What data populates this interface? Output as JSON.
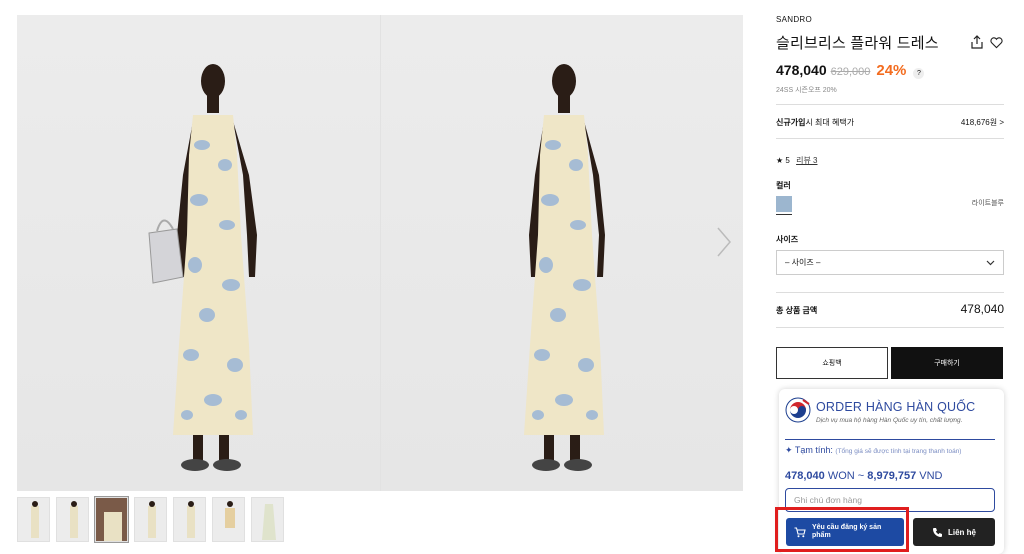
{
  "product": {
    "brand": "SANDRO",
    "title": "슬리브리스 플라워 드레스",
    "price": "478,040",
    "original_price": "629,000",
    "discount": "24%",
    "help_icon": "?",
    "season_note": "24SS 시즌오프 20%"
  },
  "benefit": {
    "label_bold": "신규가입",
    "label_rest": "시 최대 혜택가",
    "value": "418,676원 >"
  },
  "rating": {
    "star": "★ 5",
    "review_link": "리뷰 3"
  },
  "color": {
    "label": "컬러",
    "selected_name": "라이트블루",
    "swatch_color": "#9cb6cf"
  },
  "size": {
    "label": "사이즈",
    "placeholder": "– 사이즈 –"
  },
  "total": {
    "label": "총 상품 금액",
    "value": "478,040"
  },
  "buttons": {
    "cart": "쇼핑백",
    "buy": "구매하기"
  },
  "order_widget": {
    "title": "ORDER HÀNG HÀN QUỐC",
    "subtitle": "Dịch vụ mua hộ hàng Hàn Quốc uy tín, chất lượng.",
    "estimate_label": "Tạm tính:",
    "estimate_note": "(Tổng giá sẽ được tính tại trang thanh toán)",
    "price_won": "478,040",
    "won_unit": "WON",
    "tilde": "~",
    "price_vnd": "8,979,757",
    "vnd_unit": "VND",
    "note_placeholder": "Ghi chú đơn hàng",
    "request_button": "Yêu cầu đăng ký sản phẩm",
    "contact_button": "Liên hệ"
  },
  "colors": {
    "accent_orange": "#f36c1f",
    "brand_blue": "#2e4a9f",
    "highlight_red": "#e01e1e"
  }
}
